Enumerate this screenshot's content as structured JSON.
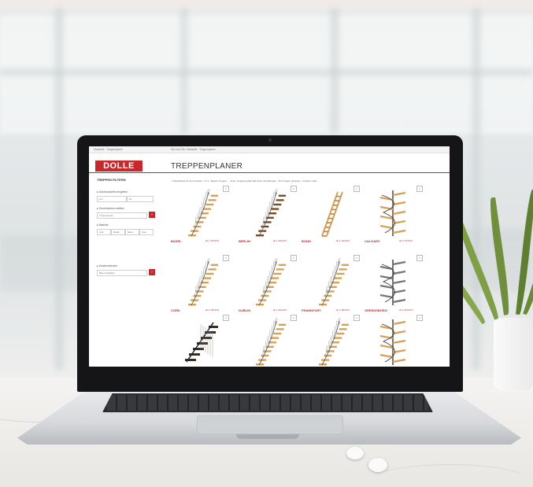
{
  "website": {
    "topbar": {
      "left": "Startseite · Treppenplaner",
      "right": "Hier sind Sie: Startseite · Treppenplaner"
    },
    "logo": "DOLLE",
    "page_title": "TREPPENPLANER",
    "filter_text": "↑ 3 Ergebnisse für Ihre Auswahl · 1 2 3 · Weitere Treppen · ↓ Preis: Treppenmodell nach Ihren Vorstellungen · 30+ Treppen gefunden · Sortieren nach",
    "sidebar": {
      "title": "TREPPEN FILTERN",
      "label1": "▸ Geschosshöhe eingeben",
      "field1a": "von",
      "field1b": "bis",
      "label2": "▸ Grundrissform wählen",
      "field2": "1/4 gewendelt",
      "label3": "▸ Material",
      "chips": [
        "Holz",
        "Metall",
        "Beton",
        "Glas"
      ],
      "label4": "▸ Sonderwünsche",
      "field4": "Bitte auswählen"
    },
    "products": [
      {
        "name": "BASEL",
        "price": "ab 1.375,00 €",
        "style": "wood-rail"
      },
      {
        "name": "BERLIN",
        "price": "ab 1.416,00 €",
        "style": "dark-wood"
      },
      {
        "name": "BONN",
        "price": "ab 1.115,00 €",
        "style": "ladder"
      },
      {
        "name": "CALGARY",
        "price": "ab 2.170,00 €",
        "style": "spiral"
      },
      {
        "name": "CORK",
        "price": "ab 1.790,00 €",
        "style": "wood-rail"
      },
      {
        "name": "DUBLIN",
        "price": "ab 1.519,00 €",
        "style": "wood-rail"
      },
      {
        "name": "FRANKFURT",
        "price": "ab 1.495,00 €",
        "style": "wood-rail"
      },
      {
        "name": "GREENSBORO",
        "price": "ab 2.415,00 €",
        "style": "spiral-dark"
      },
      {
        "name": "",
        "price": "",
        "style": "dark-steps"
      },
      {
        "name": "",
        "price": "",
        "style": "wood-rail"
      },
      {
        "name": "",
        "price": "",
        "style": "wood-rail"
      },
      {
        "name": "",
        "price": "",
        "style": "spiral-light"
      }
    ]
  },
  "colors": {
    "brand_red": "#c7282c",
    "bezel": "#151517",
    "wood": "#d4a35a"
  },
  "icons": [
    "magnifier-icon",
    "submit-arrow-icon"
  ]
}
